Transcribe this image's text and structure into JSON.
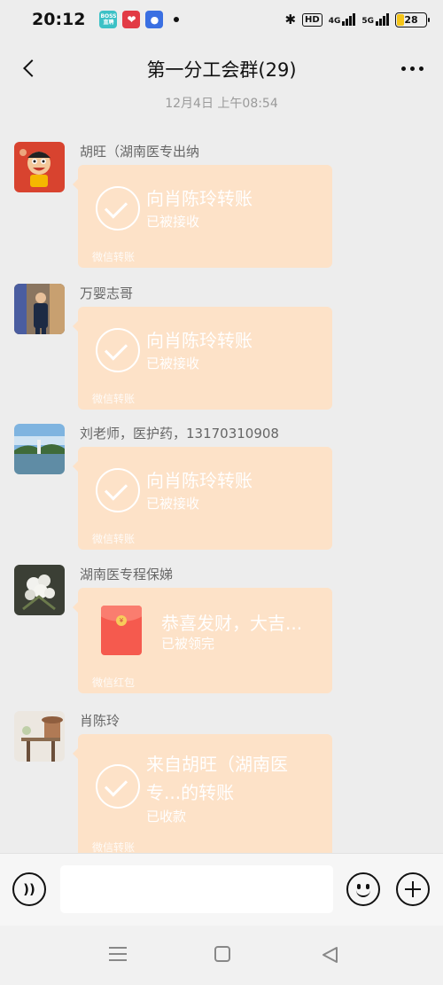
{
  "status_bar": {
    "time": "20:12",
    "apps": [
      {
        "name": "boss-zhipin-app-icon",
        "label": "BOSS\n直聘",
        "color": "#3cc1c6"
      },
      {
        "name": "heart-app-icon",
        "label": "❤",
        "color": "#e23b45"
      },
      {
        "name": "baidu-app-icon",
        "label": "🐾",
        "color": "#3a6fe2"
      }
    ],
    "hd_label": "HD",
    "network_1": "4G",
    "network_2": "5G",
    "battery": "28"
  },
  "header": {
    "title": "第一分工会群(29)"
  },
  "timestamp": "12月4日 上午08:54",
  "messages": [
    {
      "sender": "胡旺（湖南医专出纳",
      "type": "transfer",
      "title": "向肖陈玲转账",
      "status": "已被接收",
      "footer": "微信转账"
    },
    {
      "sender": "万婴志哥",
      "type": "transfer",
      "title": "向肖陈玲转账",
      "status": "已被接收",
      "footer": "微信转账"
    },
    {
      "sender": "刘老师，医护药，13170310908",
      "type": "transfer",
      "title": "向肖陈玲转账",
      "status": "已被接收",
      "footer": "微信转账"
    },
    {
      "sender": "湖南医专程保娣",
      "type": "red_packet",
      "title": "恭喜发财，大吉...",
      "status": "已被领完",
      "footer": "微信红包"
    },
    {
      "sender": "肖陈玲",
      "type": "transfer",
      "title_line1": "来自胡旺（湖南医",
      "title_line2": "专...的转账",
      "status": "已收款",
      "footer": "微信转账"
    }
  ],
  "input_bar": {
    "placeholder": ""
  },
  "colors": {
    "transfer_card": "#fde2c8",
    "background": "#ededed"
  }
}
